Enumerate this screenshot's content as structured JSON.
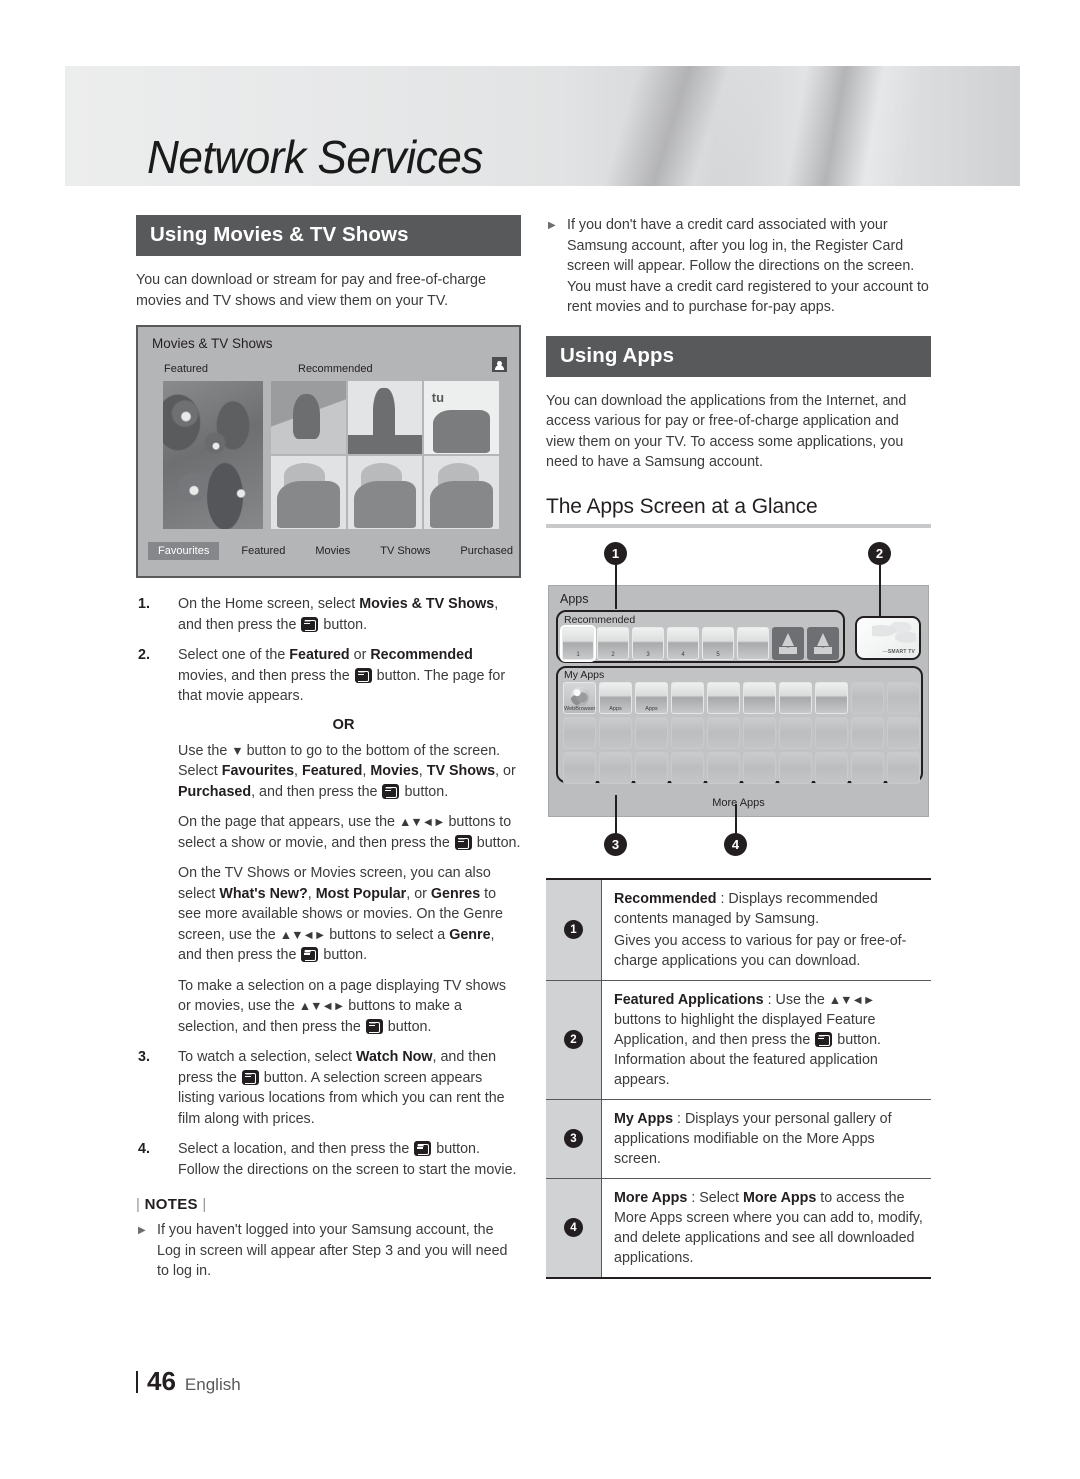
{
  "banner": {
    "title": "Network Services"
  },
  "left": {
    "section_title": "Using Movies & TV Shows",
    "intro": "You can download or stream for pay and free-of-charge movies and TV shows and view them on your TV.",
    "mock_screen": {
      "title": "Movies & TV Shows",
      "account_icon": "account-icon",
      "label_featured": "Featured",
      "label_recommended": "Recommended",
      "thumb_text": "tu",
      "nav_tabs": [
        "Favourites",
        "Featured",
        "Movies",
        "TV Shows",
        "Purchased"
      ],
      "active_tab": "Favourites"
    },
    "steps": [
      {
        "num": "1.",
        "parts": [
          {
            "t": "On the Home screen, select ",
            "s": "n"
          },
          {
            "t": "Movies & TV Shows",
            "s": "b"
          },
          {
            "t": ", and then press the ",
            "s": "n"
          },
          {
            "t": "",
            "s": "e"
          },
          {
            "t": " button.",
            "s": "n"
          }
        ]
      },
      {
        "num": "2.",
        "parts": [
          {
            "t": "Select one of the ",
            "s": "n"
          },
          {
            "t": "Featured",
            "s": "b"
          },
          {
            "t": " or ",
            "s": "n"
          },
          {
            "t": "Recommended",
            "s": "b"
          },
          {
            "t": " movies, and then press the ",
            "s": "n"
          },
          {
            "t": "",
            "s": "e"
          },
          {
            "t": " button. The page for that movie appears.",
            "s": "n"
          }
        ]
      }
    ],
    "or_label": "OR",
    "substeps": [
      {
        "parts": [
          {
            "t": "Use the ",
            "s": "n"
          },
          {
            "t": "▼",
            "s": "a"
          },
          {
            "t": " button to go to the bottom of the screen. Select ",
            "s": "n"
          },
          {
            "t": "Favourites",
            "s": "b"
          },
          {
            "t": ", ",
            "s": "n"
          },
          {
            "t": "Featured",
            "s": "b"
          },
          {
            "t": ", ",
            "s": "n"
          },
          {
            "t": "Movies",
            "s": "b"
          },
          {
            "t": ", ",
            "s": "n"
          },
          {
            "t": "TV Shows",
            "s": "b"
          },
          {
            "t": ", or ",
            "s": "n"
          },
          {
            "t": "Purchased",
            "s": "b"
          },
          {
            "t": ", and then press the ",
            "s": "n"
          },
          {
            "t": "",
            "s": "e"
          },
          {
            "t": " button.",
            "s": "n"
          }
        ]
      },
      {
        "parts": [
          {
            "t": "On the page that appears, use the ",
            "s": "n"
          },
          {
            "t": "▲▼◄►",
            "s": "a"
          },
          {
            "t": " buttons to select a show or movie, and then press the ",
            "s": "n"
          },
          {
            "t": "",
            "s": "e"
          },
          {
            "t": " button.",
            "s": "n"
          }
        ]
      },
      {
        "parts": [
          {
            "t": "On the TV Shows or Movies screen, you can also select ",
            "s": "n"
          },
          {
            "t": "What's New?",
            "s": "b"
          },
          {
            "t": ", ",
            "s": "n"
          },
          {
            "t": "Most Popular",
            "s": "b"
          },
          {
            "t": ", or ",
            "s": "n"
          },
          {
            "t": "Genres",
            "s": "b"
          },
          {
            "t": " to see more available shows or movies. On the Genre screen, use the ",
            "s": "n"
          },
          {
            "t": "▲▼◄►",
            "s": "a"
          },
          {
            "t": " buttons to select a ",
            "s": "n"
          },
          {
            "t": "Genre",
            "s": "b"
          },
          {
            "t": ", and then press the ",
            "s": "n"
          },
          {
            "t": "",
            "s": "e"
          },
          {
            "t": " button.",
            "s": "n"
          }
        ]
      },
      {
        "parts": [
          {
            "t": "To make a selection on a page displaying TV shows or movies, use the ",
            "s": "n"
          },
          {
            "t": "▲▼◄►",
            "s": "a"
          },
          {
            "t": " buttons to make a selection, and then press the ",
            "s": "n"
          },
          {
            "t": "",
            "s": "e"
          },
          {
            "t": " button.",
            "s": "n"
          }
        ]
      }
    ],
    "steps2": [
      {
        "num": "3.",
        "parts": [
          {
            "t": "To watch a selection, select ",
            "s": "n"
          },
          {
            "t": "Watch Now",
            "s": "b"
          },
          {
            "t": ", and then press the ",
            "s": "n"
          },
          {
            "t": "",
            "s": "e"
          },
          {
            "t": " button. A selection screen appears listing various locations from which you can rent the film along with prices.",
            "s": "n"
          }
        ]
      },
      {
        "num": "4.",
        "parts": [
          {
            "t": "Select a location, and then press the ",
            "s": "n"
          },
          {
            "t": "",
            "s": "e"
          },
          {
            "t": " button. Follow the directions on the screen to start the movie.",
            "s": "n"
          }
        ]
      }
    ],
    "notes_label": "NOTES",
    "notes": [
      "If you haven't logged into your Samsung account, the Log in screen will appear after Step 3 and you will need to log in."
    ]
  },
  "right": {
    "top_notes": [
      "If you don't have a credit card associated with your Samsung account, after you log in, the Register Card screen will appear. Follow the directions on the screen. You must have a credit card registered to your account to rent movies and to purchase for-pay apps."
    ],
    "section_title": "Using Apps",
    "intro": "You can download the applications from the Internet, and access various for pay or free-of-charge application and view them on your TV. To access some applications, you need to have a Samsung account.",
    "sub_head": "The Apps Screen at a Glance",
    "mock_screen": {
      "title": "Apps",
      "recommended_label": "Recommended",
      "recommended_tile_numbers": [
        "1",
        "2",
        "3",
        "4",
        "5"
      ],
      "feature_logo": "SMART TV",
      "feature_logo_dash": "—",
      "myapps_label": "My Apps",
      "myapps_labels": [
        "WebBrowser",
        "Apps",
        "Apps"
      ],
      "more_apps_label": "More Apps"
    },
    "callouts": [
      "1",
      "2",
      "3",
      "4"
    ],
    "legend": [
      {
        "num": "❶",
        "lines": [
          [
            {
              "t": "Recommended",
              "s": "b"
            },
            {
              "t": " : Displays recommended contents managed by Samsung.",
              "s": "n"
            }
          ],
          [
            {
              "t": "Gives you access to various for pay or free-of-charge applications you can download.",
              "s": "n"
            }
          ]
        ]
      },
      {
        "num": "❷",
        "lines": [
          [
            {
              "t": "Featured Applications",
              "s": "b"
            },
            {
              "t": " : Use the ",
              "s": "n"
            },
            {
              "t": "▲▼◄►",
              "s": "a"
            },
            {
              "t": " buttons to highlight the displayed Feature Application, and then press the ",
              "s": "n"
            },
            {
              "t": "",
              "s": "e"
            },
            {
              "t": " button. Information about the featured application appears.",
              "s": "n"
            }
          ]
        ]
      },
      {
        "num": "❸",
        "lines": [
          [
            {
              "t": "My Apps",
              "s": "b"
            },
            {
              "t": " : Displays your personal gallery of applications modifiable on the More Apps screen.",
              "s": "n"
            }
          ]
        ]
      },
      {
        "num": "❹",
        "lines": [
          [
            {
              "t": "More Apps",
              "s": "b"
            },
            {
              "t": " : Select ",
              "s": "n"
            },
            {
              "t": "More Apps",
              "s": "b"
            },
            {
              "t": " to access the More Apps screen where you can add to, modify, and delete applications and see all downloaded applications.",
              "s": "n"
            }
          ]
        ]
      }
    ]
  },
  "footer": {
    "page": "46",
    "language": "English"
  },
  "colors": {
    "section_bar": "#58595b",
    "rule": "#c8c9cb",
    "text": "#3b3b3d",
    "callout": "#231f20"
  }
}
